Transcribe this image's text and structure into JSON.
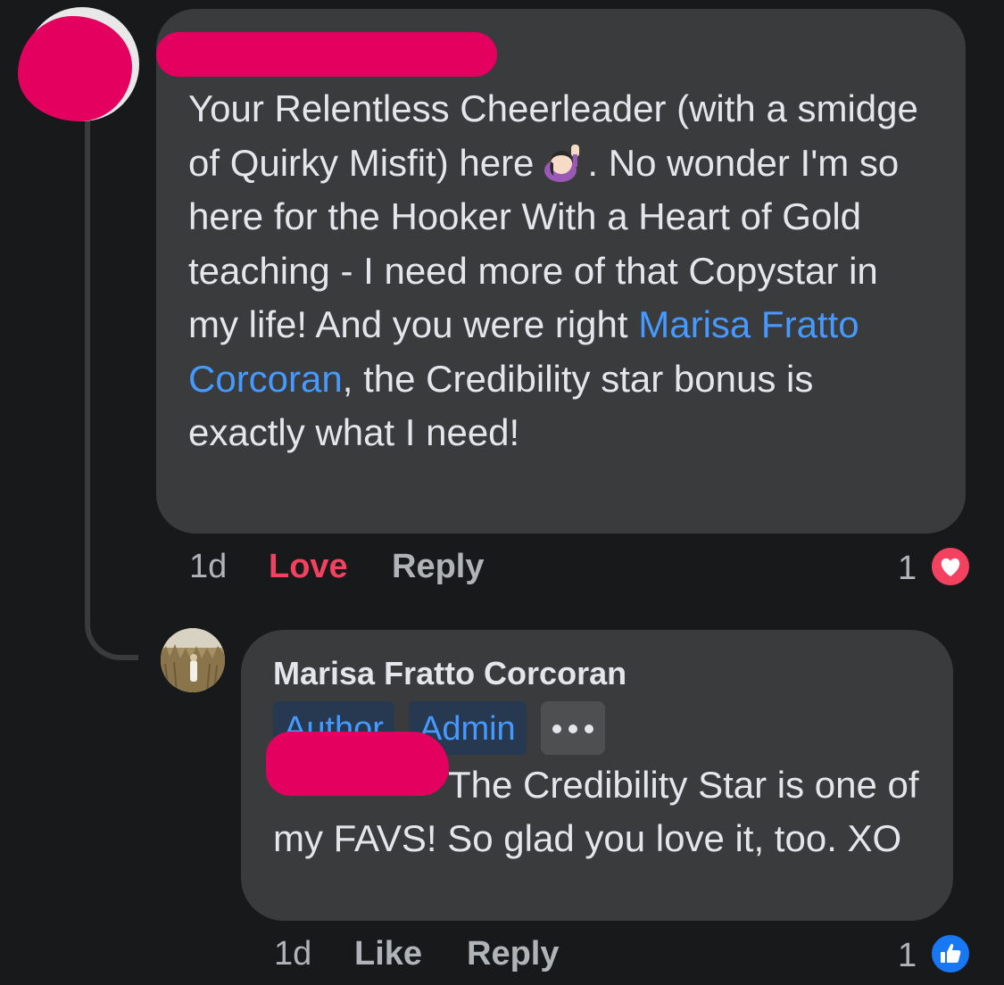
{
  "comment": {
    "text_before_emoji": "Your Relentless Cheerleader (with a smidge of Quirky Misfit) here",
    "emoji_name": "raising-hand-emoji",
    "text_after_emoji": ". No wonder I'm so here for the Hooker With a Heart of Gold teaching - I need more of that Copystar in my life! And you were right ",
    "mention": "Marisa Fratto Corcoran",
    "text_after_mention": ", the Credibility star bonus is exactly what I need!",
    "time": "1d",
    "reaction_label": "Love",
    "reply_label": "Reply",
    "reaction_count": "1",
    "reaction_icon": "heart-icon",
    "reaction_color": "#f3425f"
  },
  "reply": {
    "author": "Marisa Fratto Corcoran",
    "badges": [
      "Author",
      "Admin"
    ],
    "more_icon": "ellipsis-icon",
    "text": "The Credibility Star is one of my FAVS! So glad you love it, too. XO",
    "time": "1d",
    "like_label": "Like",
    "reply_label": "Reply",
    "reaction_count": "1",
    "reaction_icon": "thumbs-up-icon",
    "reaction_color": "#1877f2"
  },
  "colors": {
    "background": "#18191a",
    "bubble": "#3a3b3c",
    "text": "#e4e6eb",
    "secondary_text": "#b0b3b8",
    "link": "#4599ff",
    "redaction": "#e4005f"
  }
}
